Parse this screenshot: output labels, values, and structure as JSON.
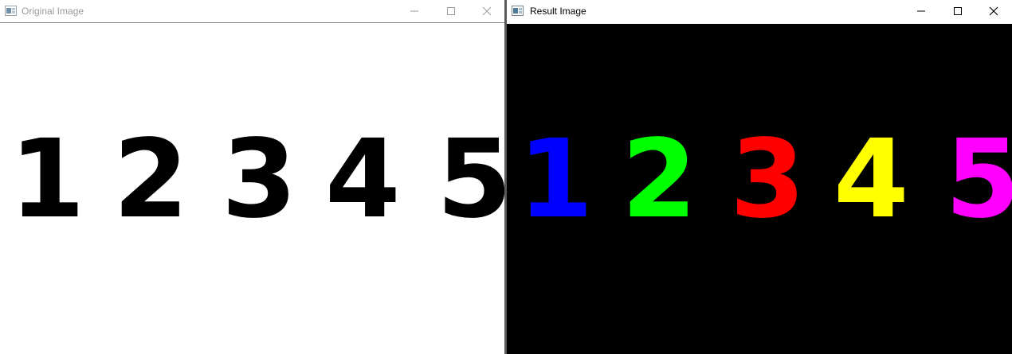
{
  "windows": {
    "original": {
      "title": "Original Image",
      "digits": [
        "1",
        "2",
        "3",
        "4",
        "5"
      ],
      "background": "#ffffff",
      "digit_color": "#000000"
    },
    "result": {
      "title": "Result Image",
      "digits": [
        "1",
        "2",
        "3",
        "4",
        "5"
      ],
      "background": "#000000",
      "digit_colors": [
        "#0000ff",
        "#00ff00",
        "#ff0000",
        "#ffff00",
        "#ff00ff"
      ]
    }
  },
  "controls": {
    "minimize_icon": "minimize-icon",
    "maximize_icon": "maximize-icon",
    "close_icon": "close-icon"
  }
}
